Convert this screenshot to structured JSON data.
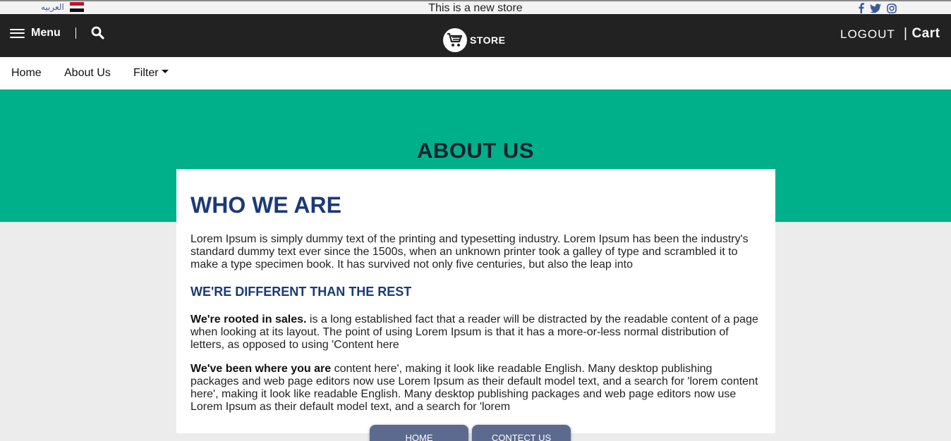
{
  "topbar": {
    "language_label": "العربيه",
    "announcement": "This is a new store",
    "socials": [
      "facebook-icon",
      "twitter-icon",
      "instagram-icon"
    ]
  },
  "header": {
    "menu_label": "Menu",
    "logo_text": "STORE",
    "logout_label": "LOGOUT",
    "cart_separator": "|",
    "cart_label": "Cart"
  },
  "nav": {
    "items": [
      "Home",
      "About Us",
      "Filter"
    ]
  },
  "hero": {
    "title": "ABOUT US"
  },
  "content": {
    "who_title": "WHO WE ARE",
    "who_text": "Lorem Ipsum is simply dummy text of the printing and typesetting industry. Lorem Ipsum has been the industry's standard dummy text ever since the 1500s, when an unknown printer took a galley of type and scrambled it to make a type specimen book. It has survived not only five centuries, but also the leap into",
    "diff_title": "WE'RE DIFFERENT THAN THE REST",
    "p2_bold": "We're rooted in sales.",
    "p2_text": " is a long established fact that a reader will be distracted by the readable content of a page when looking at its layout. The point of using Lorem Ipsum is that it has a more-or-less normal distribution of letters, as opposed to using 'Content here",
    "p3_bold": "We've been where you are",
    "p3_text": " content here', making it look like readable English. Many desktop publishing packages and web page editors now use Lorem Ipsum as their default model text, and a search for 'lorem content here', making it look like readable English. Many desktop publishing packages and web page editors now use Lorem Ipsum as their default model text, and a search for 'lorem"
  },
  "bottom_tabs": {
    "home": "HOME",
    "contact": "CONTECT US"
  },
  "colors": {
    "header_bg": "#222222",
    "hero_bg": "#00b08b",
    "heading_blue": "#1a3a78",
    "tab_bg": "#5c6a8f",
    "page_bg": "#ececec"
  }
}
